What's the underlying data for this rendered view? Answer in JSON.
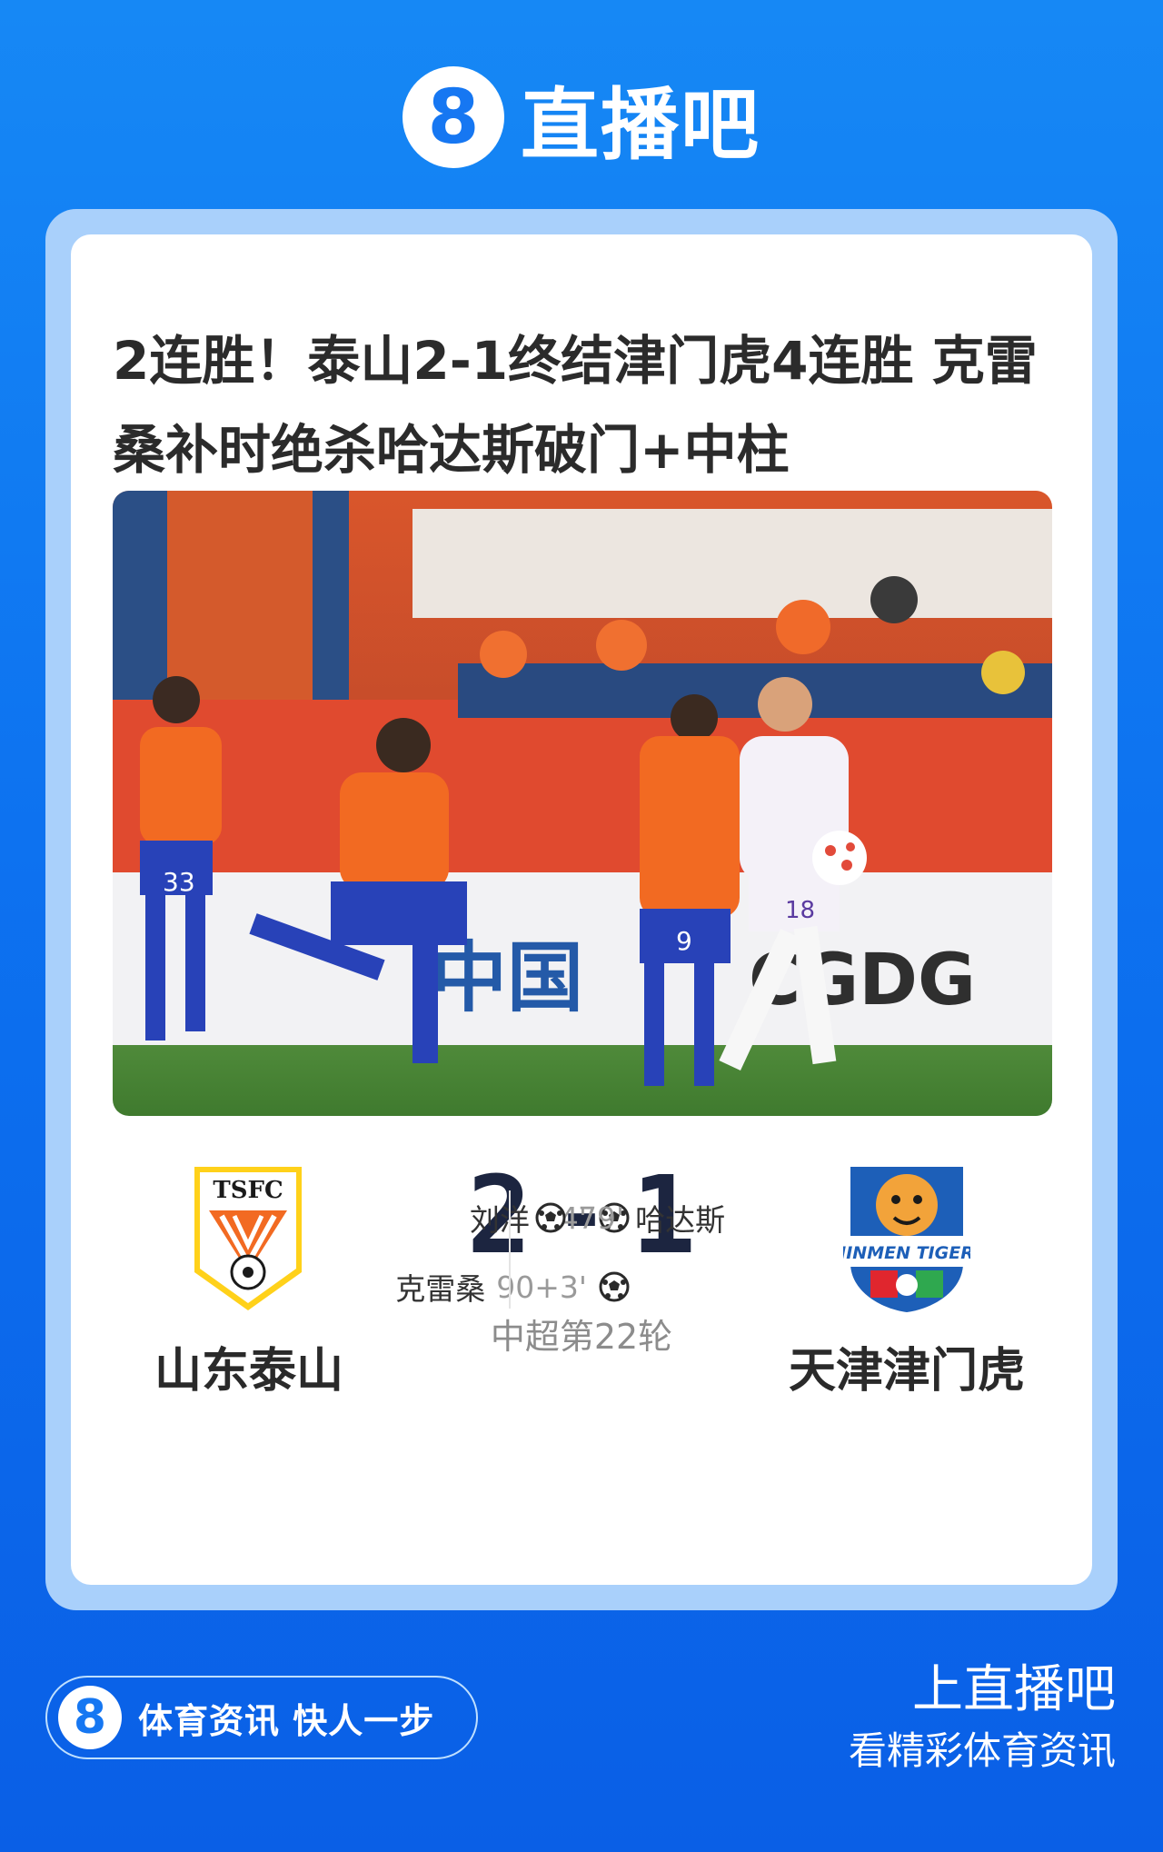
{
  "brand": {
    "badge": "8",
    "name": "直播吧"
  },
  "article": {
    "headline": "2连胜！泰山2-1终结津门虎4连胜 克雷桑补时绝杀哈达斯破门+中柱"
  },
  "photo": {
    "ad_text_left": "中国",
    "ad_text_right": "CGDG",
    "player_numbers": [
      "33",
      "9",
      "18"
    ]
  },
  "match": {
    "home_team": {
      "name": "山东泰山",
      "crest_text": "TSFC"
    },
    "away_team": {
      "name": "天津津门虎",
      "crest_text": "JINMEN TIGER"
    },
    "score": {
      "home": "2",
      "separator": "-",
      "away": "1"
    },
    "league": "中超第22轮",
    "home_scorers": [
      {
        "name": "刘洋",
        "minute": "84'"
      },
      {
        "name": "克雷桑",
        "minute": "90+3'"
      }
    ],
    "away_scorers": [
      {
        "name": "哈达斯",
        "minute": "79'"
      }
    ]
  },
  "footer": {
    "badge": "8",
    "slogan": "体育资讯 快人一步",
    "cta_line1": "上直播吧",
    "cta_line2": "看精彩体育资讯"
  },
  "colors": {
    "background": "#0d72f0",
    "card_frame": "#a9d0fb",
    "score_text": "#1c2540",
    "home_orange": "#f26a22",
    "away_blue": "#1d5fb8"
  }
}
